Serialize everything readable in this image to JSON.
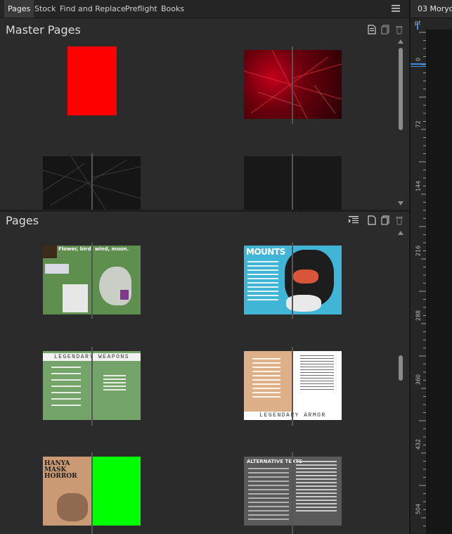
{
  "tabs": [
    {
      "label": "Pages",
      "active": true
    },
    {
      "label": "Stock",
      "active": false
    },
    {
      "label": "Find and Replace",
      "active": false
    },
    {
      "label": "Preflight",
      "active": false
    },
    {
      "label": "Books",
      "active": false
    }
  ],
  "document_tab": {
    "label": "03 Moryo"
  },
  "ruler": {
    "unit": "pt",
    "labels": [
      "0",
      "72",
      "144",
      "216",
      "288",
      "360",
      "432",
      "504"
    ]
  },
  "master_pages": {
    "title": "Master Pages"
  },
  "pages": {
    "title": "Pages"
  },
  "thumb_text": {
    "flower": "Flower, bird, wind, moon.",
    "mounts": "MOUNTS",
    "weapons": "LEGENDARY WEAPONS",
    "armor": "LEGENDARY ARMOR",
    "hanya": "HANYA MASK HORROR",
    "alt": "ALTERNATIVE TEXTS"
  },
  "colors": {
    "accent": "#3a8ee6",
    "red": "#ff0000",
    "green": "#00ff00"
  }
}
